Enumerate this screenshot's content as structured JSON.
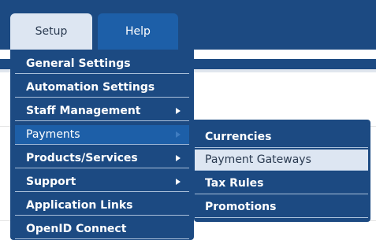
{
  "tabs": {
    "setup": "Setup",
    "help": "Help"
  },
  "setup_menu": {
    "items": [
      {
        "label": "General Settings",
        "has_submenu": false
      },
      {
        "label": "Automation Settings",
        "has_submenu": false
      },
      {
        "label": "Staff Management",
        "has_submenu": true
      },
      {
        "label": "Payments",
        "has_submenu": true,
        "active": true
      },
      {
        "label": "Products/Services",
        "has_submenu": true
      },
      {
        "label": "Support",
        "has_submenu": true
      },
      {
        "label": "Application Links",
        "has_submenu": false
      },
      {
        "label": "OpenID Connect",
        "has_submenu": false
      }
    ]
  },
  "payments_submenu": {
    "items": [
      {
        "label": "Currencies"
      },
      {
        "label": "Payment Gateways",
        "highlighted": true
      },
      {
        "label": "Tax Rules"
      },
      {
        "label": "Promotions"
      }
    ]
  },
  "colors": {
    "navy": "#1c4a82",
    "active_blue": "#1d5fa8",
    "highlight": "#dde6f2"
  }
}
